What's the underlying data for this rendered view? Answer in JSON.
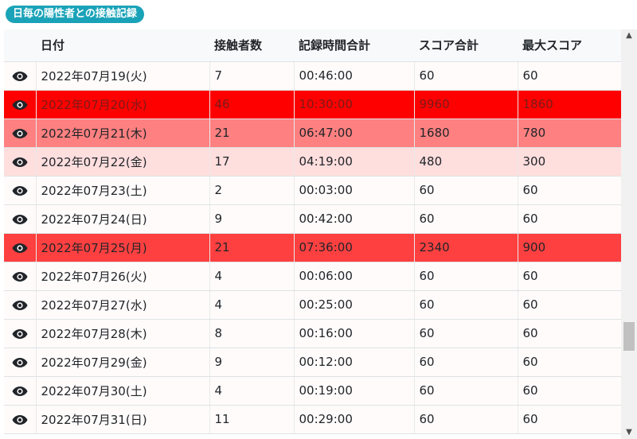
{
  "title": "日毎の陽性者との接触記録",
  "icons": {
    "row_action": "eye-icon",
    "scroll_up": "chevron-up-icon",
    "scroll_down": "chevron-down-icon"
  },
  "colors": {
    "badge": "#1aa3b8",
    "level0": "#fffbfb",
    "level1": "#ffdede",
    "level2": "#ff8080",
    "level3": "#ff4040",
    "level4": "#ff0000"
  },
  "table": {
    "headers": [
      "",
      "日付",
      "接触者数",
      "記録時間合計",
      "スコア合計",
      "最大スコア"
    ],
    "rows": [
      {
        "date": "2022年07月19(火)",
        "count": "7",
        "time": "00:46:00",
        "score": "60",
        "max": "60",
        "level": 0
      },
      {
        "date": "2022年07月20(水)",
        "count": "46",
        "time": "10:30:00",
        "score": "9960",
        "max": "1860",
        "level": 4
      },
      {
        "date": "2022年07月21(木)",
        "count": "21",
        "time": "06:47:00",
        "score": "1680",
        "max": "780",
        "level": 2
      },
      {
        "date": "2022年07月22(金)",
        "count": "17",
        "time": "04:19:00",
        "score": "480",
        "max": "300",
        "level": 1
      },
      {
        "date": "2022年07月23(土)",
        "count": "2",
        "time": "00:03:00",
        "score": "60",
        "max": "60",
        "level": 0
      },
      {
        "date": "2022年07月24(日)",
        "count": "9",
        "time": "00:42:00",
        "score": "60",
        "max": "60",
        "level": 0
      },
      {
        "date": "2022年07月25(月)",
        "count": "21",
        "time": "07:36:00",
        "score": "2340",
        "max": "900",
        "level": 3
      },
      {
        "date": "2022年07月26(火)",
        "count": "4",
        "time": "00:06:00",
        "score": "60",
        "max": "60",
        "level": 0
      },
      {
        "date": "2022年07月27(水)",
        "count": "4",
        "time": "00:25:00",
        "score": "60",
        "max": "60",
        "level": 0
      },
      {
        "date": "2022年07月28(木)",
        "count": "8",
        "time": "00:16:00",
        "score": "60",
        "max": "60",
        "level": 0
      },
      {
        "date": "2022年07月29(金)",
        "count": "9",
        "time": "00:12:00",
        "score": "60",
        "max": "60",
        "level": 0
      },
      {
        "date": "2022年07月30(土)",
        "count": "4",
        "time": "00:19:00",
        "score": "60",
        "max": "60",
        "level": 0
      },
      {
        "date": "2022年07月31(日)",
        "count": "11",
        "time": "00:29:00",
        "score": "60",
        "max": "60",
        "level": 0
      }
    ]
  }
}
